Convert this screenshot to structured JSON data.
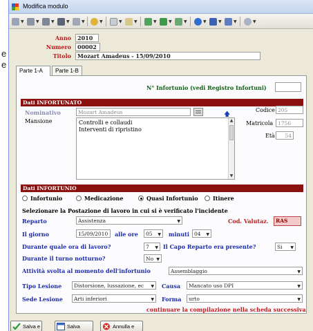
{
  "window": {
    "title": "Modifica modulo"
  },
  "left_strip": [
    "e",
    "e"
  ],
  "header": {
    "anno_label": "Anno",
    "anno_value": "2010",
    "numero_label": "Numero",
    "numero_value": "00002",
    "titolo_label": "Titolo",
    "titolo_value": "Mozart Amadeus - 15/09/2010"
  },
  "tabs": [
    {
      "label": "Parte 1-A",
      "active": true
    },
    {
      "label": "Parte 1-B",
      "active": false
    }
  ],
  "registro_label": "N° Infortunio (vedi Registro Infortuni)",
  "registro_value": "",
  "dati_infortunato": {
    "section_title": "Dati INFORTUNATO",
    "nominativo_label": "Nominativo",
    "nominativo_value": "Mozart Amadeus",
    "codice_label": "Codice",
    "codice_value": "205",
    "matricola_label": "Matricola",
    "matricola_value": "1756",
    "eta_label": "Età",
    "eta_value": "54",
    "mansione_label": "Mansione",
    "mansione_lines": [
      "Controlli e collaudi",
      "Interventi di ripristino"
    ]
  },
  "dati_infortunio": {
    "section_title": "Dati INFORTUNIO",
    "types": [
      {
        "label": "Infortunio",
        "selected": false
      },
      {
        "label": "Medicazione",
        "selected": false
      },
      {
        "label": "Quasi Infortunio",
        "selected": true
      },
      {
        "label": "Itinere",
        "selected": false
      }
    ],
    "postazione_heading": "Selezionare la Postazione di lavoro in cui si è verificato l'incidente",
    "reparto_label": "Reparto",
    "reparto_value": "Assistenza",
    "cod_valutaz_label": "Cod. Valutaz.",
    "cod_valutaz_value": "RAS",
    "giorno_label": "Il giorno",
    "giorno_value": "15/09/2010",
    "ore_label": "alle ore",
    "ore_value": "05",
    "minuti_label": "minuti",
    "minuti_value": "04",
    "ora_lavoro_label": "Durante quale ora di lavoro?",
    "ora_lavoro_value": "7",
    "capo_reparto_label": "Il Capo Reparto era presente?",
    "capo_reparto_value": "Si",
    "turno_label": "Durante il turno notturno?",
    "turno_value": "No",
    "attivita_label": "Attività svolta al momento dell'infortunio",
    "attivita_value": "Assemblaggio",
    "tipo_lesione_label": "Tipo Lesione",
    "tipo_lesione_value": "Distorsione, lussazione, ec",
    "causa_label": "Causa",
    "causa_value": "Mancato uso DPI",
    "sede_lesione_label": "Sede Lesione",
    "sede_lesione_value": "Arti inferiori",
    "forma_label": "Forma",
    "forma_value": "urto",
    "continue_note": "continuare la compilazione nella scheda successiva"
  },
  "buttons": {
    "salva_chiudi": "Salva e",
    "salva": "Salva",
    "annulla": "Annulla e"
  },
  "colors": {
    "section_bar": "#8b1010",
    "label_blue": "#1b2aa8",
    "label_red": "#c0181a"
  }
}
